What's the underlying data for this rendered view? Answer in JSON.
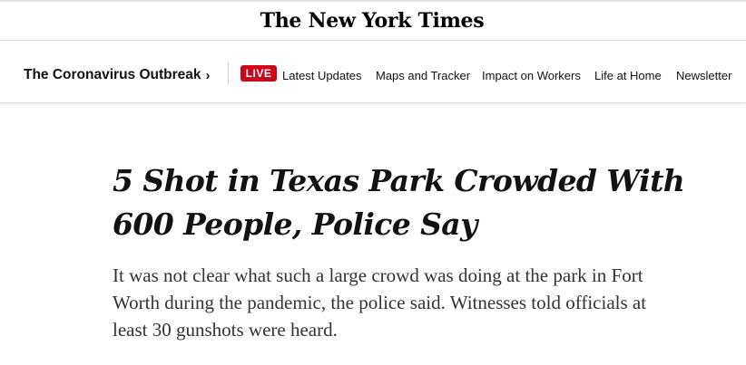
{
  "masthead": {
    "logo_text": "The New York Times"
  },
  "nav": {
    "section_label": "The Coronavirus Outbreak",
    "chevron": "›",
    "live_badge": "LIVE",
    "items": [
      {
        "label": "Latest Updates"
      },
      {
        "label": "Maps and Tracker"
      },
      {
        "label": "Impact on Workers"
      },
      {
        "label": "Life at Home"
      },
      {
        "label": "Newsletter"
      }
    ]
  },
  "article": {
    "headline": "5 Shot in Texas Park Crowded With 600 People, Police Say",
    "summary": "It was not clear what such a large crowd was doing at the park in Fort Worth during the pandemic, the police said. Witnesses told officials at least 30 gunshots were heard."
  },
  "colors": {
    "live_badge_bg": "#d0021b",
    "text": "#121212",
    "summary_text": "#333333",
    "divider": "#e2e2e2"
  }
}
